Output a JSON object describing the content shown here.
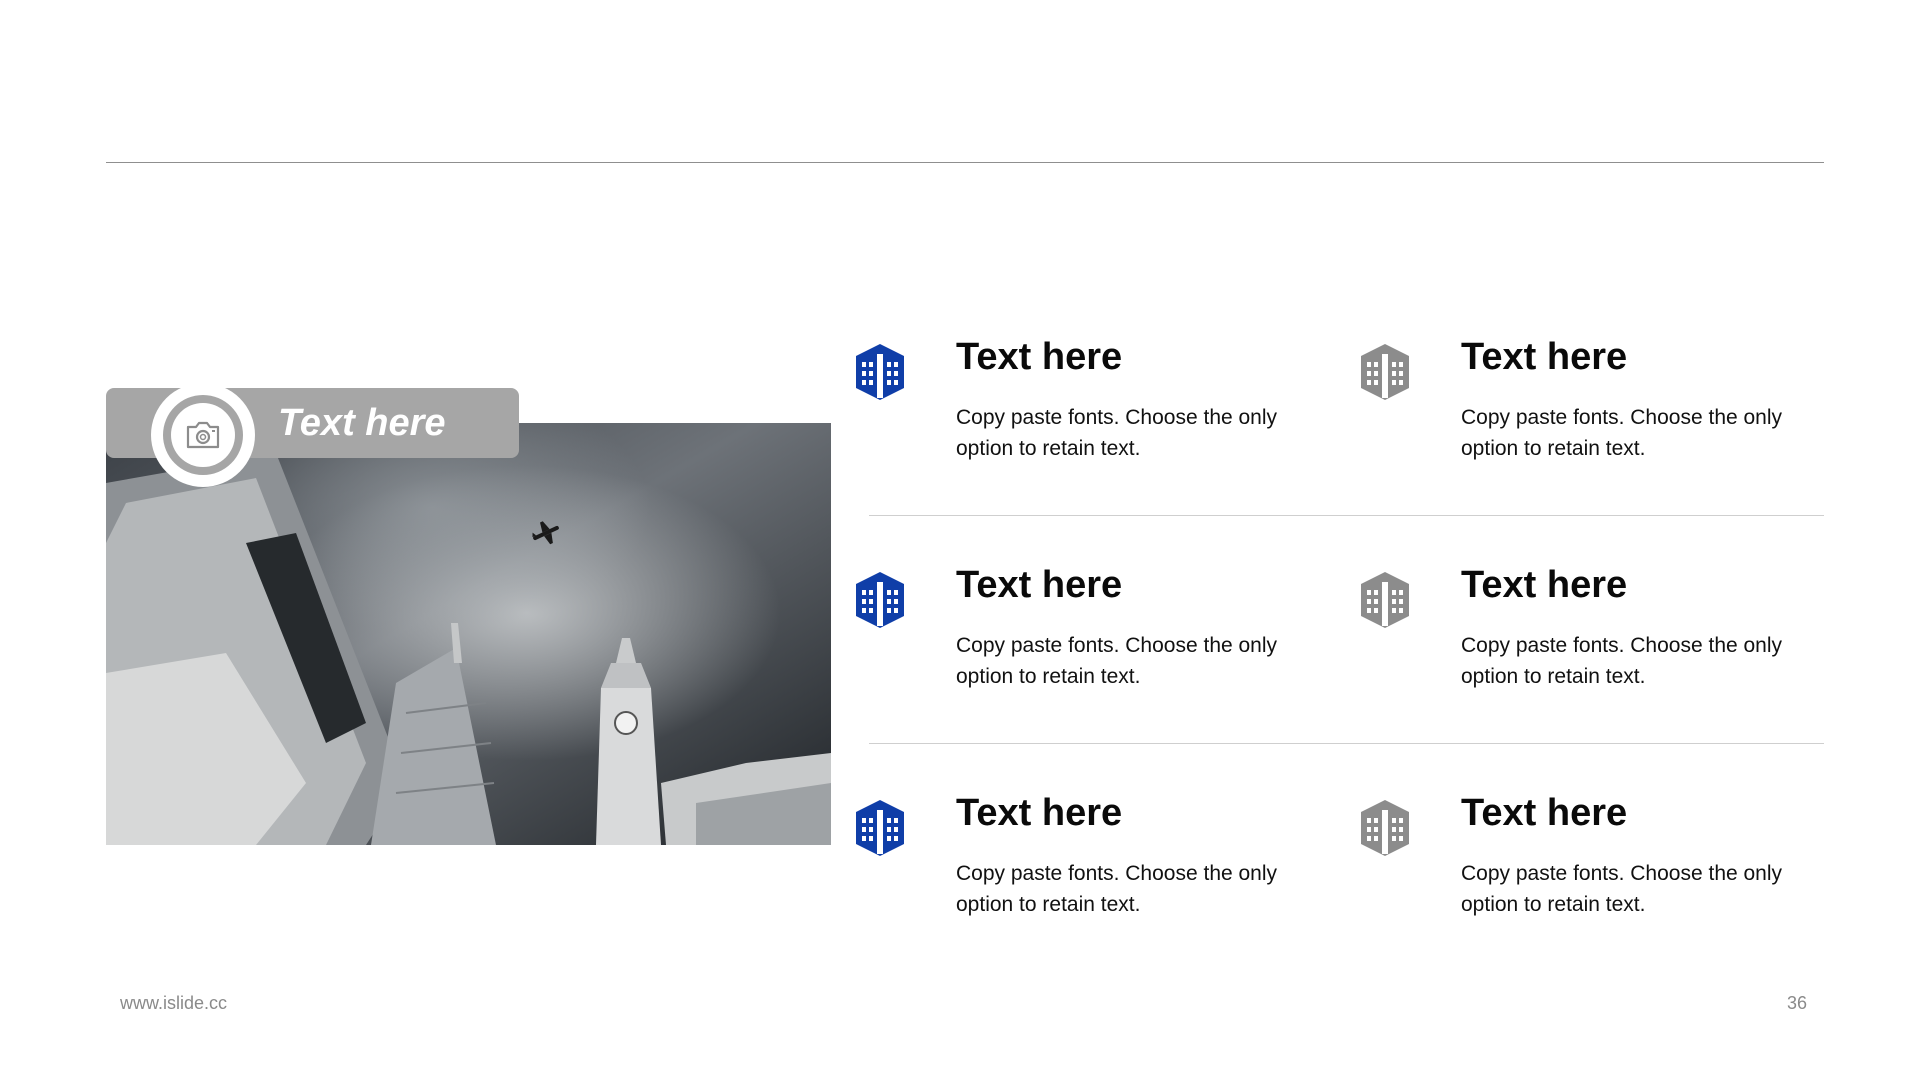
{
  "photo": {
    "label": "Text here",
    "camera_icon": "camera-icon"
  },
  "colors": {
    "accent": "#0f3ea8",
    "secondary": "#8c8c8c",
    "label_bg": "#a6a6a6"
  },
  "features": [
    {
      "title": "Text here",
      "desc": "Copy paste fonts. Choose the only option to retain text.",
      "icon": "building-icon",
      "color": "#0f3ea8"
    },
    {
      "title": "Text here",
      "desc": "Copy paste fonts. Choose the only option to retain text.",
      "icon": "building-icon",
      "color": "#8c8c8c"
    },
    {
      "title": "Text here",
      "desc": "Copy paste fonts. Choose the only option to retain text.",
      "icon": "building-icon",
      "color": "#0f3ea8"
    },
    {
      "title": "Text here",
      "desc": "Copy paste fonts. Choose the only option to retain text.",
      "icon": "building-icon",
      "color": "#8c8c8c"
    },
    {
      "title": "Text here",
      "desc": "Copy paste fonts. Choose the only option to retain text.",
      "icon": "building-icon",
      "color": "#0f3ea8"
    },
    {
      "title": "Text here",
      "desc": "Copy paste fonts. Choose the only option to retain text.",
      "icon": "building-icon",
      "color": "#8c8c8c"
    }
  ],
  "footer": {
    "url": "www.islide.cc",
    "page": "36"
  }
}
